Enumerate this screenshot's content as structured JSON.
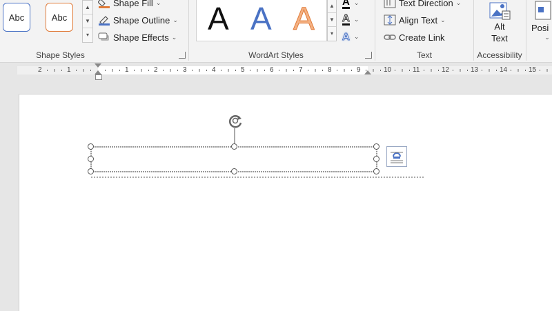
{
  "ribbon": {
    "shape_styles": {
      "label": "Shape Styles",
      "abc1": "Abc",
      "abc2": "Abc",
      "fill": "Shape Fill",
      "outline": "Shape Outline",
      "effects": "Shape Effects"
    },
    "wordart": {
      "label": "WordArt Styles",
      "letters": [
        "A",
        "A",
        "A"
      ],
      "text_fill_glyph": "A",
      "text_outline_glyph": "A",
      "text_effects_glyph": "A"
    },
    "text": {
      "label": "Text",
      "direction": "Text Direction",
      "align": "Align Text",
      "link": "Create Link"
    },
    "accessibility": {
      "label": "Accessibility",
      "alt_line1": "Alt",
      "alt_line2": "Text"
    },
    "position": {
      "label": "Posi"
    }
  },
  "ruler": {
    "numbers": [
      "2",
      "1",
      "1",
      "2",
      "3",
      "4",
      "5",
      "6",
      "7",
      "8",
      "9",
      "10",
      "11",
      "12",
      "13",
      "14",
      "15"
    ]
  },
  "colors": {
    "accent_blue": "#4a72c4",
    "wordart_orange": "#f4b183",
    "outline_orange": "#e07b39"
  }
}
